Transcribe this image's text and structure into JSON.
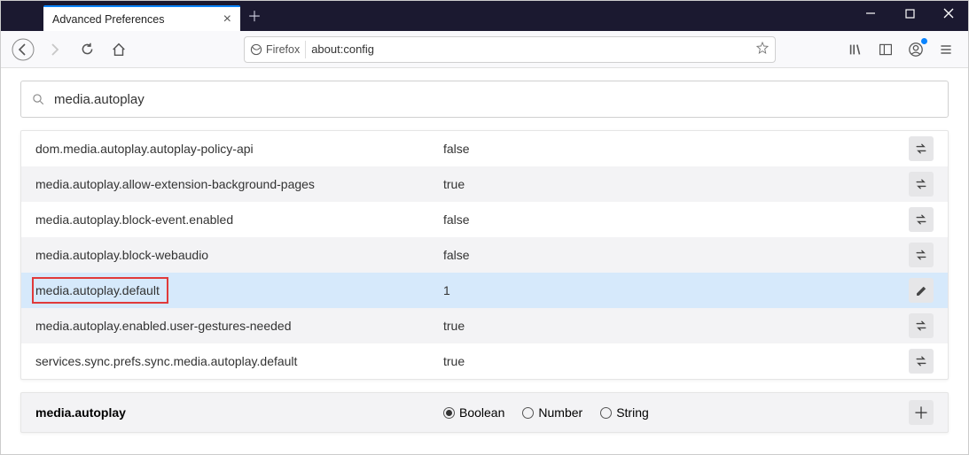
{
  "window": {
    "tab_title": "Advanced Preferences"
  },
  "toolbar": {
    "identity_label": "Firefox",
    "url": "about:config"
  },
  "search": {
    "value": "media.autoplay"
  },
  "prefs": [
    {
      "name": "dom.media.autoplay.autoplay-policy-api",
      "value": "false",
      "action": "toggle",
      "highlighted": false
    },
    {
      "name": "media.autoplay.allow-extension-background-pages",
      "value": "true",
      "action": "toggle",
      "highlighted": false
    },
    {
      "name": "media.autoplay.block-event.enabled",
      "value": "false",
      "action": "toggle",
      "highlighted": false
    },
    {
      "name": "media.autoplay.block-webaudio",
      "value": "false",
      "action": "toggle",
      "highlighted": false
    },
    {
      "name": "media.autoplay.default",
      "value": "1",
      "action": "edit",
      "highlighted": true
    },
    {
      "name": "media.autoplay.enabled.user-gestures-needed",
      "value": "true",
      "action": "toggle",
      "highlighted": false
    },
    {
      "name": "services.sync.prefs.sync.media.autoplay.default",
      "value": "true",
      "action": "toggle",
      "highlighted": false
    }
  ],
  "new_pref": {
    "name": "media.autoplay",
    "types": [
      "Boolean",
      "Number",
      "String"
    ],
    "selected": "Boolean"
  }
}
